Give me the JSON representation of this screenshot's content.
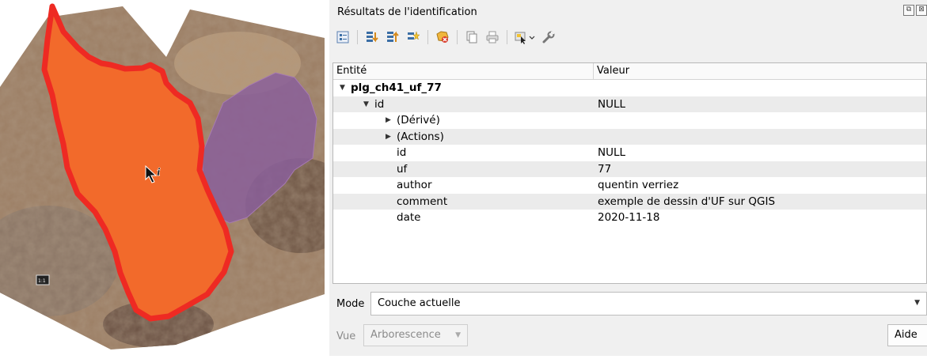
{
  "panel": {
    "title": "Résultats de l'identification",
    "title_icons": [
      "⧉",
      "⊠"
    ]
  },
  "toolbar": {
    "buttons": [
      "expand-tree-icon",
      "expand-all-icon",
      "collapse-all-icon",
      "expand-new-icon",
      "clear-results-icon",
      "copy-feature-icon",
      "print-icon",
      "select-features-icon",
      "settings-wrench-icon"
    ]
  },
  "table": {
    "header_entity": "Entité",
    "header_value": "Valeur",
    "rows": [
      {
        "label": "plg_ch41_uf_77",
        "value": ""
      },
      {
        "label": "id",
        "value": "NULL"
      },
      {
        "label": "(Dérivé)",
        "value": ""
      },
      {
        "label": "(Actions)",
        "value": ""
      },
      {
        "label": "id",
        "value": "NULL"
      },
      {
        "label": "uf",
        "value": "77"
      },
      {
        "label": "author",
        "value": "quentin verriez"
      },
      {
        "label": "comment",
        "value": "exemple de dessin d'UF sur QGIS"
      },
      {
        "label": "date",
        "value": "2020-11-18"
      }
    ]
  },
  "mode": {
    "label": "Mode",
    "value": "Couche actuelle"
  },
  "view": {
    "label": "Vue",
    "value": "Arborescence"
  },
  "help_button": "Aide",
  "map": {
    "scale_marker": "1:1",
    "orange_fill": "#f26a2b",
    "orange_border": "#ee2a23",
    "purple_fill": "#8a5f9a"
  }
}
